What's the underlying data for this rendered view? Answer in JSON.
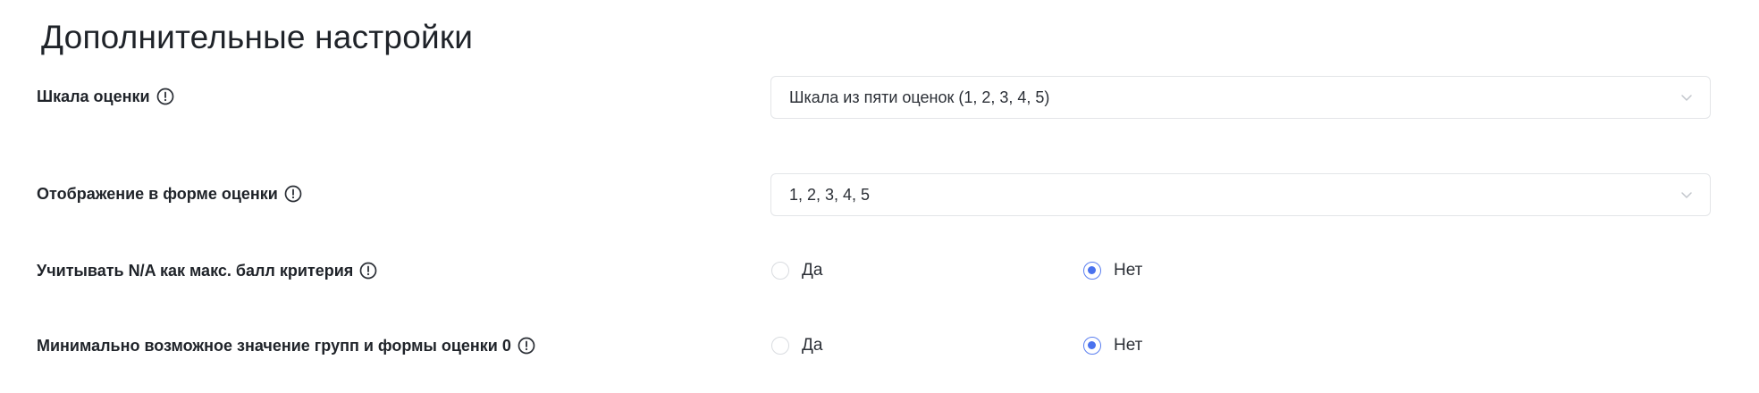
{
  "section": {
    "title": "Дополнительные настройки"
  },
  "rows": [
    {
      "label": "Шкала оценки",
      "type": "select",
      "value": "Шкала из пяти оценок (1, 2, 3, 4, 5)"
    },
    {
      "label": "Отображение в форме оценки",
      "type": "select",
      "value": "1, 2, 3, 4, 5"
    },
    {
      "label": "Учитывать N/A как макс. балл критерия",
      "type": "radio",
      "options": [
        {
          "label": "Да",
          "checked": false
        },
        {
          "label": "Нет",
          "checked": true
        }
      ]
    },
    {
      "label": "Минимально возможное значение групп и формы оценки 0",
      "type": "radio",
      "options": [
        {
          "label": "Да",
          "checked": false
        },
        {
          "label": "Нет",
          "checked": true
        }
      ]
    }
  ],
  "colors": {
    "accent": "#4a72ee",
    "border": "#e3e5e8",
    "text": "#1f2329"
  },
  "icons": {
    "info": "info-circle-icon",
    "dropdown": "chevron-down-icon"
  }
}
